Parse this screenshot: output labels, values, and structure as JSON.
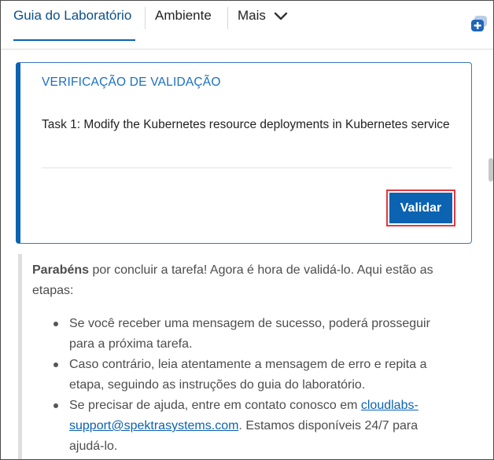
{
  "tabs": {
    "guide": "Guia do Laboratório",
    "environment": "Ambiente",
    "more": "Mais"
  },
  "validation_card": {
    "title": "VERIFICAÇÃO DE VALIDAÇÃO",
    "task": "Task 1: Modify the Kubernetes resource deployments in Kubernetes service",
    "validate_label": "Validar"
  },
  "instructions": {
    "intro_bold": "Parabéns",
    "intro_rest": " por concluir a tarefa! Agora é hora de validá-lo. Aqui estão as etapas:",
    "bullet_1": "Se você receber uma mensagem de sucesso, poderá prosseguir para a próxima tarefa.",
    "bullet_2": "Caso contrário, leia atentamente a mensagem de erro e repita a etapa, seguindo as instruções do guia do laboratório.",
    "bullet_3_pre": "Se precisar de ajuda, entre em contato conosco em ",
    "bullet_3_link": "cloudlabs-support@spektrasystems.com",
    "bullet_3_post": ". Estamos disponíveis 24/7 para ajudá-lo."
  },
  "icons": {
    "more_chevron": "chevron-down-icon",
    "floating_action": "add-chat-icon"
  },
  "colors": {
    "accent": "#0b63b1",
    "title_blue": "#1a6fc2",
    "highlight_red": "#e0393e"
  }
}
